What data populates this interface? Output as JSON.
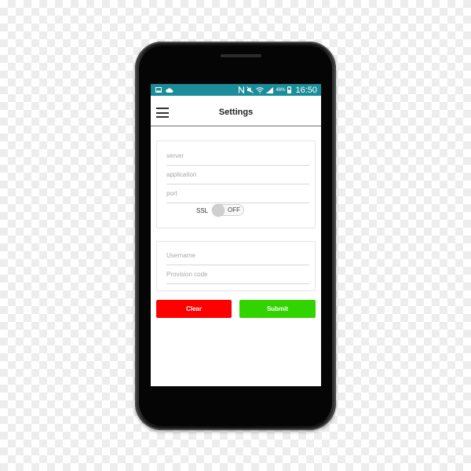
{
  "colors": {
    "status_bar": "#1b8d9a",
    "clear_button": "#ff0000",
    "submit_button": "#32d400"
  },
  "status_bar": {
    "left_icons": [
      "image-icon",
      "cloud-icon"
    ],
    "right_icons": [
      "nfc-icon",
      "mute-icon",
      "wifi-icon",
      "signal-icon",
      "battery-icon"
    ],
    "battery": "48%",
    "time": "16:50"
  },
  "app_bar": {
    "menu_icon": "hamburger-menu-icon",
    "title": "Settings"
  },
  "server_form": {
    "server_placeholder": "server",
    "application_placeholder": "application",
    "port_placeholder": "port",
    "ssl_label": "SSL",
    "ssl_state": "OFF"
  },
  "auth_form": {
    "username_placeholder": "Username",
    "provision_code_placeholder": "Provision code"
  },
  "buttons": {
    "clear": "Clear",
    "submit": "Submit"
  }
}
